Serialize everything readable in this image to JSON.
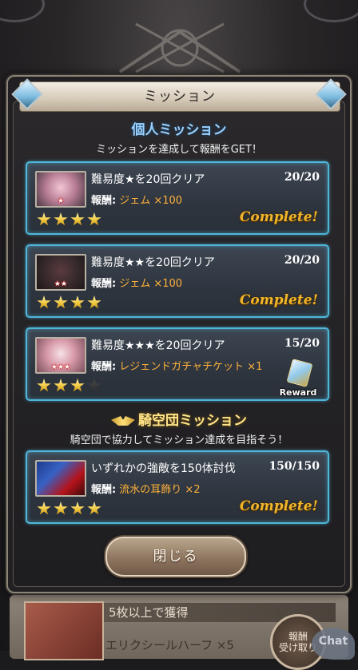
{
  "modal": {
    "title": "ミッション",
    "close_label": "閉じる"
  },
  "personal": {
    "heading": "個人ミッション",
    "subtitle": "ミッションを達成して報酬をGET！",
    "missions": [
      {
        "title": "難易度★を20回クリア",
        "progress": "20/20",
        "reward_label": "報酬:",
        "reward": "ジェム ×100",
        "stars_filled": 4,
        "stars_total": 4,
        "status": "Complete!",
        "thumb_badge": "★"
      },
      {
        "title": "難易度★★を20回クリア",
        "progress": "20/20",
        "reward_label": "報酬:",
        "reward": "ジェム ×100",
        "stars_filled": 4,
        "stars_total": 4,
        "status": "Complete!",
        "thumb_badge": "★★"
      },
      {
        "title": "難易度★★★を20回クリア",
        "progress": "15/20",
        "reward_label": "報酬:",
        "reward": "レジェンドガチャチケット ×1",
        "stars_filled": 3,
        "stars_total": 4,
        "status": "Reward",
        "thumb_badge": "★★★"
      }
    ]
  },
  "guild": {
    "heading": "騎空団ミッション",
    "subtitle": "騎空団で協力してミッション達成を目指そう！",
    "missions": [
      {
        "title": "いずれかの強敵を150体討伐",
        "progress": "150/150",
        "reward_label": "報酬:",
        "reward": "流水の耳飾り ×2",
        "stars_filled": 4,
        "stars_total": 4,
        "status": "Complete!"
      }
    ]
  },
  "background": {
    "card_title": "5枚以上で獲得",
    "card_item": "エリクシールハーフ ×5",
    "card_button": "報酬\n受け取り",
    "chat_label": "Chat"
  },
  "colors": {
    "card_border": "#4fb6d8",
    "complete_text": "#f0b52a",
    "reward_text": "#ffb13a",
    "personal_heading": "#9bd2ff",
    "guild_heading": "#ffe58a"
  }
}
